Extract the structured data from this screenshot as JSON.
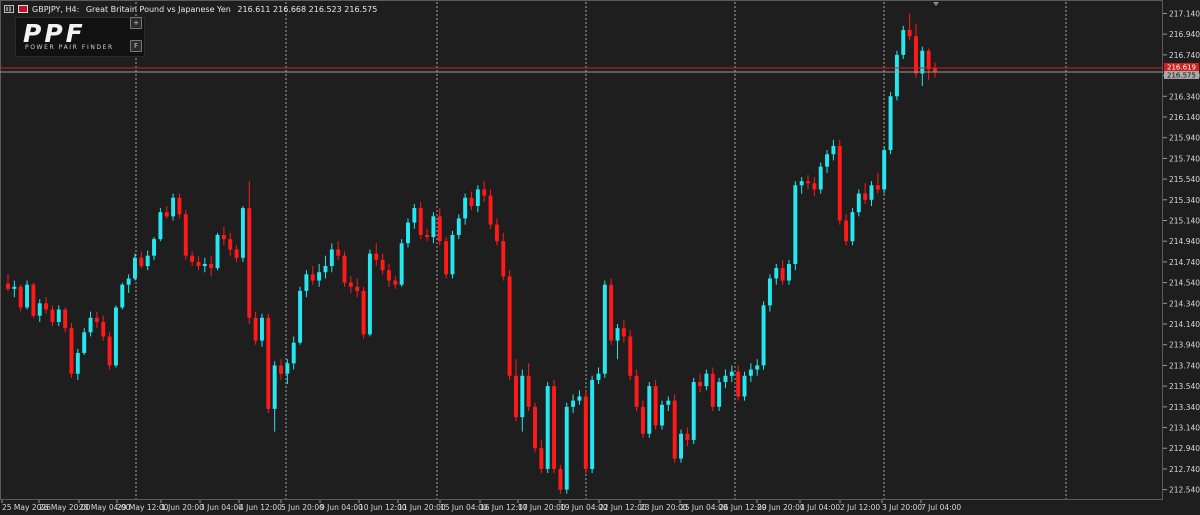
{
  "header": {
    "symbol": "GBPJPY, H4:",
    "description": "Great Britain Pound vs Japanese Yen",
    "ohlc": "216.611 216.668 216.523 216.575"
  },
  "logo": {
    "text": "PPF",
    "tagline": "POWER PAIR FINDER",
    "plus_button": "+",
    "f_button": "F"
  },
  "colors": {
    "background": "#1e1e1e",
    "bull": "#26e6f0",
    "bear": "#ff1a1a",
    "axis_text": "#d8d8d8",
    "separator": "#a8a8a8",
    "price_line": "#d02020"
  },
  "chart_data": {
    "type": "candlestick",
    "timeframe": "H4",
    "symbol": "GBPJPY",
    "ylim": [
      212.44,
      217.27
    ],
    "y_ticks": [
      "217.140",
      "216.940",
      "216.740",
      "216.540",
      "216.340",
      "216.140",
      "215.940",
      "215.740",
      "215.540",
      "215.340",
      "215.140",
      "214.940",
      "214.740",
      "214.540",
      "214.340",
      "214.140",
      "213.940",
      "213.740",
      "213.540",
      "213.340",
      "213.140",
      "212.940",
      "212.740",
      "212.540"
    ],
    "x_labels": [
      "25 May 2026",
      "26 May 20:00",
      "28 May 04:00",
      "29 May 12:00",
      "1 Jun 20:00",
      "3 Jun 04:00",
      "4 Jun 12:00",
      "5 Jun 20:00",
      "9 Jun 04:00",
      "10 Jun 12:00",
      "11 Jun 20:00",
      "15 Jun 04:00",
      "16 Jun 12:00",
      "17 Jun 20:00",
      "19 Jun 04:00",
      "22 Jun 12:00",
      "23 Jun 20:00",
      "25 Jun 04:00",
      "26 Jun 12:00",
      "29 Jun 20:00",
      "1 Jul 04:00",
      "2 Jul 12:00",
      "3 Jul 20:00",
      "7 Jul 04:00"
    ],
    "day_separators": [
      "29 May",
      "5 Jun",
      "12 Jun",
      "19 Jun",
      "26 Jun",
      "3 Jul",
      "10 Jul"
    ],
    "bid_price": 216.575,
    "ask_label": "216.619",
    "candles": [
      [
        214.53,
        214.62,
        214.46,
        214.48
      ],
      [
        214.48,
        214.56,
        214.4,
        214.5
      ],
      [
        214.5,
        214.52,
        214.26,
        214.3
      ],
      [
        214.3,
        214.56,
        214.28,
        214.52
      ],
      [
        214.52,
        214.54,
        214.2,
        214.22
      ],
      [
        214.22,
        214.38,
        214.16,
        214.34
      ],
      [
        214.34,
        214.4,
        214.24,
        214.28
      ],
      [
        214.28,
        214.32,
        214.12,
        214.16
      ],
      [
        214.16,
        214.32,
        214.12,
        214.28
      ],
      [
        214.28,
        214.3,
        214.06,
        214.1
      ],
      [
        214.1,
        214.15,
        213.62,
        213.66
      ],
      [
        213.66,
        213.9,
        213.6,
        213.86
      ],
      [
        213.86,
        214.1,
        213.84,
        214.06
      ],
      [
        214.06,
        214.26,
        214.02,
        214.2
      ],
      [
        214.2,
        214.26,
        214.1,
        214.16
      ],
      [
        214.16,
        214.22,
        213.98,
        214.02
      ],
      [
        214.02,
        214.06,
        213.7,
        213.74
      ],
      [
        213.74,
        214.32,
        213.72,
        214.3
      ],
      [
        214.3,
        214.54,
        214.28,
        214.52
      ],
      [
        214.52,
        214.62,
        214.44,
        214.58
      ],
      [
        214.58,
        214.82,
        214.56,
        214.78
      ],
      [
        214.78,
        214.84,
        214.68,
        214.7
      ],
      [
        214.7,
        214.85,
        214.66,
        214.8
      ],
      [
        214.8,
        214.98,
        214.76,
        214.96
      ],
      [
        214.96,
        215.26,
        214.94,
        215.22
      ],
      [
        215.22,
        215.28,
        215.16,
        215.18
      ],
      [
        215.18,
        215.4,
        215.14,
        215.36
      ],
      [
        215.36,
        215.4,
        215.16,
        215.2
      ],
      [
        215.2,
        215.24,
        214.76,
        214.8
      ],
      [
        214.8,
        214.84,
        214.7,
        214.74
      ],
      [
        214.74,
        214.8,
        214.66,
        214.7
      ],
      [
        214.7,
        214.78,
        214.64,
        214.72
      ],
      [
        214.72,
        214.8,
        214.6,
        214.68
      ],
      [
        214.68,
        215.02,
        214.66,
        215.0
      ],
      [
        215.0,
        215.08,
        214.9,
        214.96
      ],
      [
        214.96,
        215.02,
        214.8,
        214.86
      ],
      [
        214.86,
        214.9,
        214.74,
        214.78
      ],
      [
        214.78,
        215.28,
        214.74,
        215.26
      ],
      [
        215.26,
        215.52,
        214.14,
        214.2
      ],
      [
        214.2,
        214.26,
        213.94,
        213.98
      ],
      [
        213.98,
        214.24,
        213.92,
        214.2
      ],
      [
        214.2,
        214.24,
        213.28,
        213.32
      ],
      [
        213.32,
        213.78,
        213.1,
        213.74
      ],
      [
        213.74,
        213.8,
        213.6,
        213.66
      ],
      [
        213.66,
        213.8,
        213.56,
        213.76
      ],
      [
        213.76,
        214.02,
        213.7,
        213.96
      ],
      [
        213.96,
        214.5,
        213.94,
        214.46
      ],
      [
        214.46,
        214.66,
        214.4,
        214.62
      ],
      [
        214.62,
        214.7,
        214.52,
        214.56
      ],
      [
        214.56,
        214.72,
        214.5,
        214.64
      ],
      [
        214.64,
        214.8,
        214.58,
        214.7
      ],
      [
        214.7,
        214.92,
        214.64,
        214.86
      ],
      [
        214.86,
        214.94,
        214.76,
        214.8
      ],
      [
        214.8,
        214.84,
        214.5,
        214.54
      ],
      [
        214.54,
        214.6,
        214.44,
        214.5
      ],
      [
        214.5,
        214.58,
        214.4,
        214.46
      ],
      [
        214.46,
        214.5,
        214.0,
        214.04
      ],
      [
        214.04,
        214.86,
        214.02,
        214.82
      ],
      [
        214.82,
        214.92,
        214.7,
        214.76
      ],
      [
        214.76,
        214.82,
        214.62,
        214.66
      ],
      [
        214.66,
        214.72,
        214.5,
        214.56
      ],
      [
        214.56,
        214.6,
        214.48,
        214.52
      ],
      [
        214.52,
        214.96,
        214.5,
        214.92
      ],
      [
        214.92,
        215.16,
        214.88,
        215.12
      ],
      [
        215.12,
        215.3,
        215.06,
        215.26
      ],
      [
        215.26,
        215.32,
        214.96,
        215.0
      ],
      [
        215.0,
        215.06,
        214.94,
        214.98
      ],
      [
        214.98,
        215.22,
        214.92,
        215.18
      ],
      [
        215.18,
        215.26,
        214.9,
        214.94
      ],
      [
        214.94,
        214.98,
        214.58,
        214.62
      ],
      [
        214.62,
        215.04,
        214.58,
        215.0
      ],
      [
        215.0,
        215.2,
        214.96,
        215.16
      ],
      [
        215.16,
        215.4,
        215.1,
        215.36
      ],
      [
        215.36,
        215.42,
        215.24,
        215.28
      ],
      [
        215.28,
        215.48,
        215.22,
        215.44
      ],
      [
        215.44,
        215.52,
        215.32,
        215.38
      ],
      [
        215.38,
        215.44,
        215.06,
        215.1
      ],
      [
        215.1,
        215.16,
        214.9,
        214.94
      ],
      [
        214.94,
        215.02,
        214.56,
        214.6
      ],
      [
        214.6,
        214.66,
        213.6,
        213.64
      ],
      [
        213.64,
        213.8,
        213.2,
        213.24
      ],
      [
        213.24,
        213.7,
        213.1,
        213.64
      ],
      [
        213.64,
        213.76,
        213.3,
        213.34
      ],
      [
        213.34,
        213.38,
        212.9,
        212.94
      ],
      [
        212.94,
        213.02,
        212.7,
        212.74
      ],
      [
        212.74,
        213.58,
        212.7,
        213.54
      ],
      [
        213.54,
        213.6,
        212.7,
        212.74
      ],
      [
        212.74,
        212.78,
        212.5,
        212.54
      ],
      [
        212.54,
        213.38,
        212.5,
        213.34
      ],
      [
        213.34,
        213.46,
        213.28,
        213.4
      ],
      [
        213.4,
        213.5,
        213.36,
        213.44
      ],
      [
        213.44,
        213.5,
        212.7,
        212.74
      ],
      [
        212.74,
        213.64,
        212.7,
        213.6
      ],
      [
        213.6,
        213.72,
        213.56,
        213.66
      ],
      [
        213.66,
        214.56,
        213.62,
        214.52
      ],
      [
        214.52,
        214.58,
        213.94,
        213.98
      ],
      [
        213.98,
        214.14,
        213.8,
        214.1
      ],
      [
        214.1,
        214.18,
        213.96,
        214.02
      ],
      [
        214.02,
        214.08,
        213.6,
        213.64
      ],
      [
        213.64,
        213.7,
        213.3,
        213.34
      ],
      [
        213.34,
        213.4,
        213.04,
        213.08
      ],
      [
        213.08,
        213.58,
        213.04,
        213.54
      ],
      [
        213.54,
        213.6,
        213.12,
        213.16
      ],
      [
        213.16,
        213.4,
        213.12,
        213.36
      ],
      [
        213.36,
        213.44,
        213.3,
        213.4
      ],
      [
        213.4,
        213.46,
        212.8,
        212.84
      ],
      [
        212.84,
        213.12,
        212.8,
        213.08
      ],
      [
        213.08,
        213.14,
        212.96,
        213.02
      ],
      [
        213.02,
        213.62,
        212.98,
        213.58
      ],
      [
        213.58,
        213.66,
        213.48,
        213.54
      ],
      [
        213.54,
        213.7,
        213.5,
        213.66
      ],
      [
        213.66,
        213.72,
        213.3,
        213.34
      ],
      [
        213.34,
        213.62,
        213.3,
        213.58
      ],
      [
        213.58,
        213.7,
        213.52,
        213.64
      ],
      [
        213.64,
        213.74,
        213.58,
        213.68
      ],
      [
        213.68,
        213.74,
        213.4,
        213.44
      ],
      [
        213.44,
        213.68,
        213.4,
        213.64
      ],
      [
        213.64,
        213.76,
        213.58,
        213.7
      ],
      [
        213.7,
        213.8,
        213.64,
        213.74
      ],
      [
        213.74,
        214.36,
        213.7,
        214.32
      ],
      [
        214.32,
        214.62,
        214.26,
        214.58
      ],
      [
        214.58,
        214.72,
        214.52,
        214.68
      ],
      [
        214.68,
        214.76,
        214.52,
        214.56
      ],
      [
        214.56,
        214.76,
        214.52,
        214.72
      ],
      [
        214.72,
        215.52,
        214.66,
        215.48
      ],
      [
        215.48,
        215.56,
        215.4,
        215.52
      ],
      [
        215.52,
        215.58,
        215.44,
        215.5
      ],
      [
        215.5,
        215.56,
        215.38,
        215.44
      ],
      [
        215.44,
        215.7,
        215.4,
        215.66
      ],
      [
        215.66,
        215.82,
        215.6,
        215.78
      ],
      [
        215.78,
        215.92,
        215.72,
        215.86
      ],
      [
        215.86,
        215.92,
        215.1,
        215.14
      ],
      [
        215.14,
        215.2,
        214.9,
        214.94
      ],
      [
        214.94,
        215.26,
        214.9,
        215.22
      ],
      [
        215.22,
        215.44,
        215.18,
        215.4
      ],
      [
        215.4,
        215.5,
        215.3,
        215.34
      ],
      [
        215.34,
        215.52,
        215.28,
        215.48
      ],
      [
        215.48,
        215.6,
        215.4,
        215.44
      ],
      [
        215.44,
        215.86,
        215.4,
        215.82
      ],
      [
        215.82,
        216.38,
        215.78,
        216.34
      ],
      [
        216.34,
        216.78,
        216.3,
        216.74
      ],
      [
        216.74,
        217.02,
        216.7,
        216.98
      ],
      [
        216.98,
        217.14,
        216.88,
        216.92
      ],
      [
        216.92,
        217.04,
        216.52,
        216.56
      ],
      [
        216.56,
        216.82,
        216.44,
        216.78
      ],
      [
        216.78,
        216.8,
        216.5,
        216.6
      ],
      [
        216.611,
        216.668,
        216.523,
        216.575
      ]
    ]
  }
}
